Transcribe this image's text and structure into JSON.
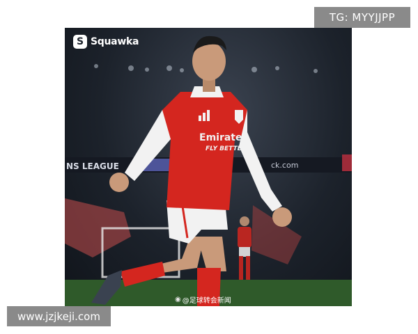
{
  "photo": {
    "brand_text": "Squawka",
    "brand_glyph": "S",
    "kit_sponsor_line1": "Emirates",
    "kit_sponsor_line2": "FLY BETTER",
    "banner_text": "NS LEAGUE",
    "banner_text_right": "ck.com",
    "weibo_icon": "weibo-icon",
    "weibo_credit": "@足球转会新闻"
  },
  "watermarks": {
    "telegram": "TG: MYYJJPP",
    "site": "www.jzjkeji.com"
  },
  "colors": {
    "kit_red": "#d4261f",
    "kit_white": "#f2f2f2",
    "pitch": "#2f5a2a",
    "overlay_gray": "#8a8a8a"
  }
}
